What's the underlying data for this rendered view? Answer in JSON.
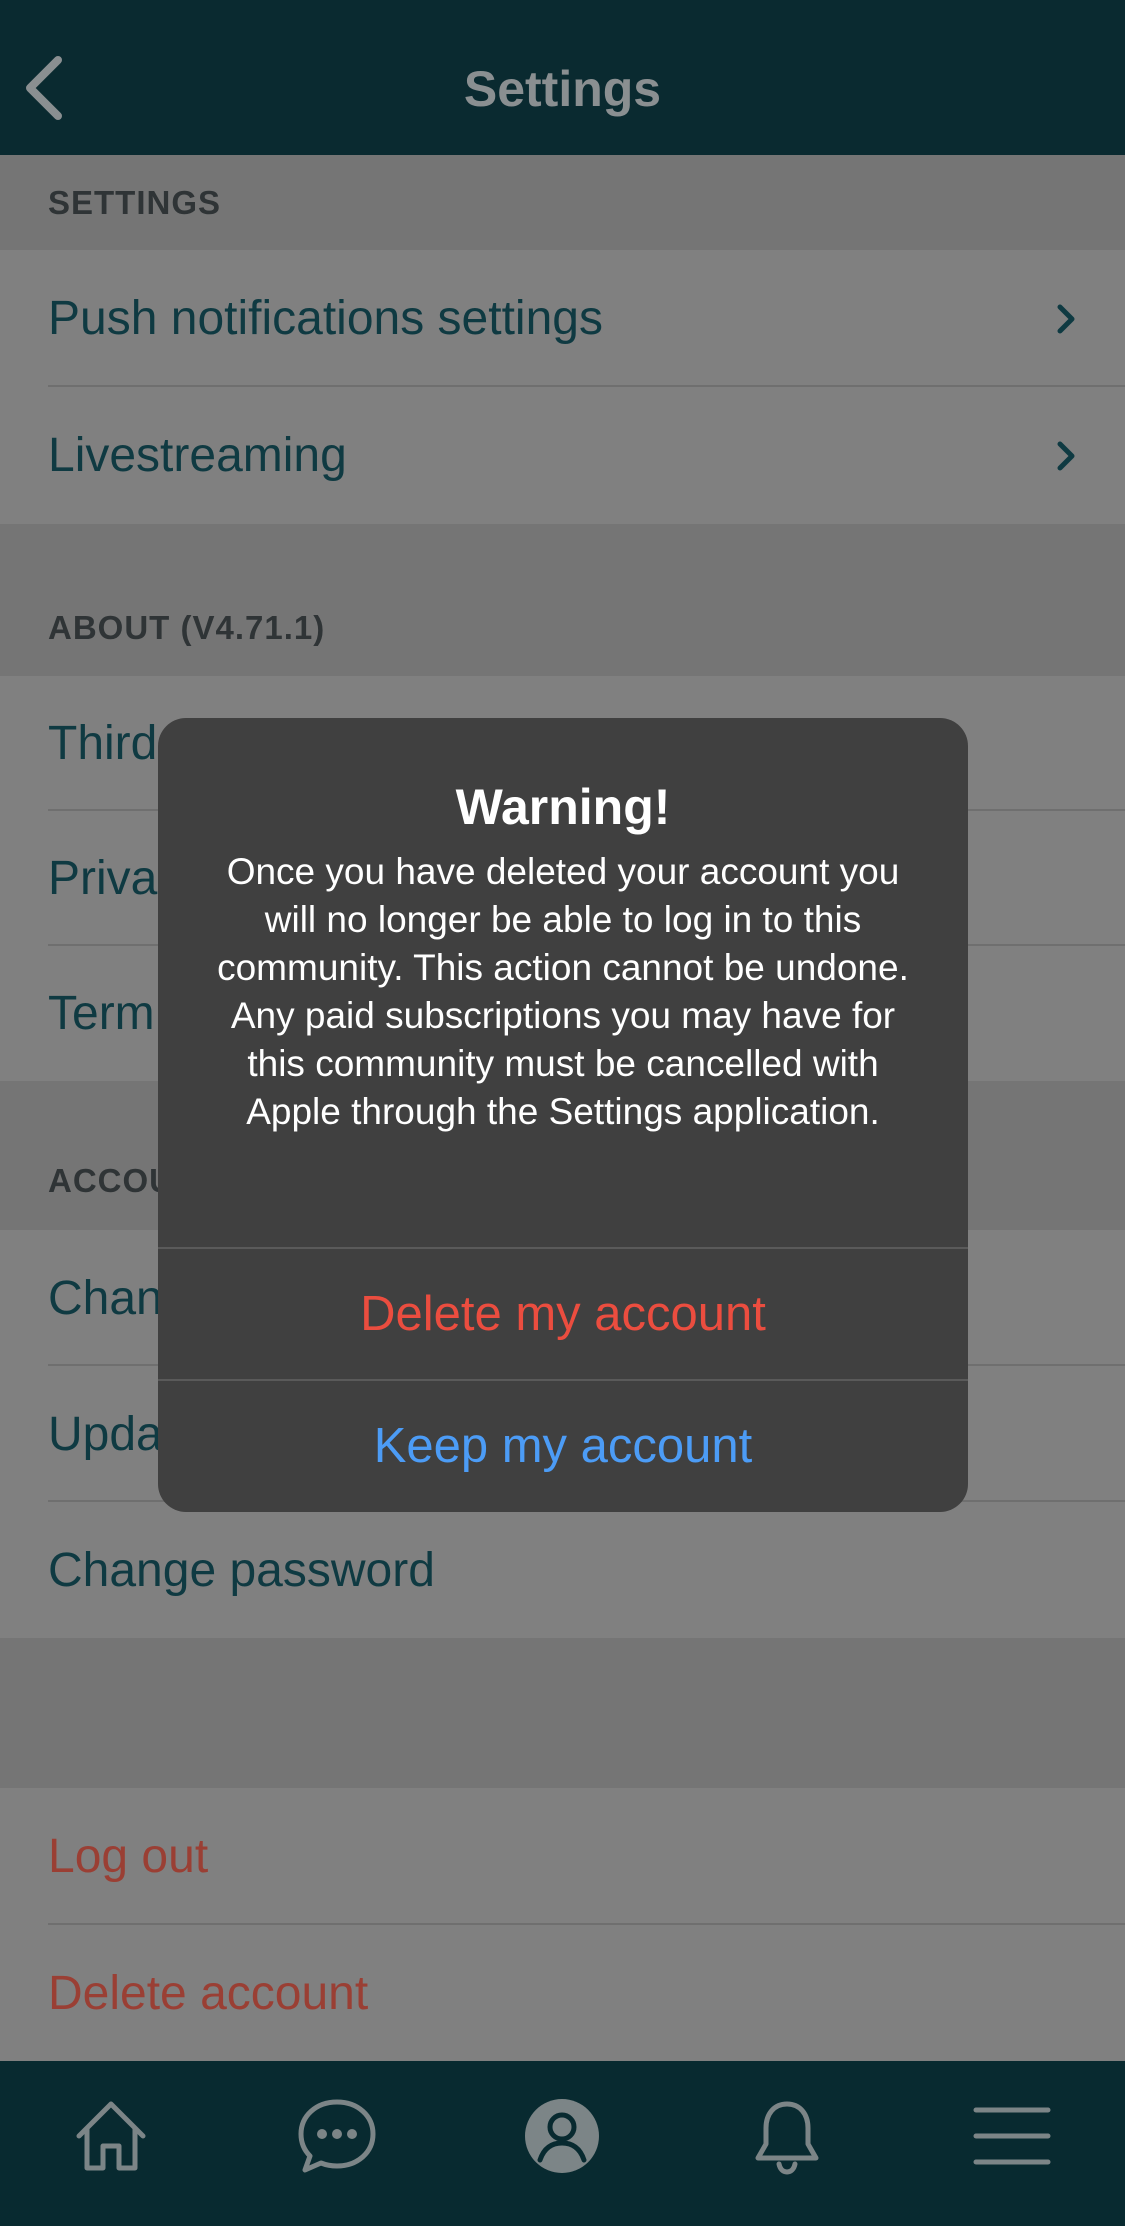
{
  "header": {
    "title": "Settings",
    "back_icon": "chevron-left-icon"
  },
  "sections": {
    "settings_label": "SETTINGS",
    "about_label": "ABOUT (V4.71.1)",
    "account_label": "ACCOU"
  },
  "rows": {
    "push_notifications": "Push notifications settings",
    "livestreaming": "Livestreaming",
    "third_party": "Third",
    "privacy": "Priva",
    "terms": "Term",
    "change_first": "Chan",
    "update": "Upda",
    "change_password": "Change password",
    "log_out": "Log out",
    "delete_account": "Delete account"
  },
  "dialog": {
    "title": "Warning!",
    "message": "Once you have deleted your account you will no longer be able to log in to this community. This action cannot be undone. Any paid subscriptions you may have for this community must be cancelled with Apple through the Settings application.",
    "delete_label": "Delete my account",
    "keep_label": "Keep my account"
  },
  "tabbar": {
    "items": [
      "home-icon",
      "chat-icon",
      "profile-icon",
      "bell-icon",
      "menu-icon"
    ]
  },
  "colors": {
    "header_bg": "#0a2a30",
    "tabbar_bg": "#082a30",
    "dialog_bg": "#404040",
    "delete_red": "#eb4d3f",
    "keep_blue": "#4c9cf6",
    "danger_row": "#9a3f34",
    "row_text": "#0f3a42"
  }
}
